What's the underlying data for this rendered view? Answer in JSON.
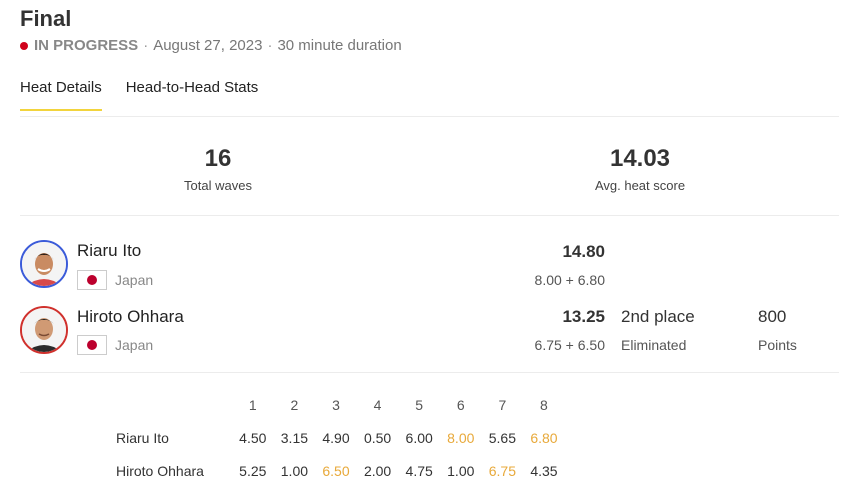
{
  "header": {
    "title": "Final",
    "status": "IN PROGRESS",
    "date": "August 27, 2023",
    "duration": "30 minute duration"
  },
  "tabs": [
    {
      "label": "Heat Details",
      "active": true
    },
    {
      "label": "Head-to-Head Stats",
      "active": false
    }
  ],
  "stats": {
    "total_waves": {
      "value": "16",
      "label": "Total waves"
    },
    "avg_score": {
      "value": "14.03",
      "label": "Avg. heat score"
    }
  },
  "riders": [
    {
      "name": "Riaru Ito",
      "country": "Japan",
      "score": "14.80",
      "breakdown": "8.00 + 6.80"
    },
    {
      "name": "Hiroto Ohhara",
      "country": "Japan",
      "score": "13.25",
      "breakdown": "6.75 + 6.50",
      "place": "2nd place",
      "place_status": "Eliminated",
      "points": "800",
      "points_label": "Points"
    }
  ],
  "wave_table": {
    "headers": [
      "1",
      "2",
      "3",
      "4",
      "5",
      "6",
      "7",
      "8"
    ],
    "rows": [
      {
        "rider": "Riaru Ito",
        "scores": [
          "4.50",
          "3.15",
          "4.90",
          "0.50",
          "6.00",
          "8.00",
          "5.65",
          "6.80"
        ],
        "best": [
          5,
          7
        ]
      },
      {
        "rider": "Hiroto Ohhara",
        "scores": [
          "5.25",
          "1.00",
          "6.50",
          "2.00",
          "4.75",
          "1.00",
          "6.75",
          "4.35"
        ],
        "best": [
          2,
          6
        ]
      }
    ]
  },
  "colors": {
    "accent_tab": "#f2d43d",
    "status_dot": "#d0021b",
    "best_wave": "#e8a93a",
    "rider1_ring": "#3b5bd9",
    "rider2_ring": "#d0312d"
  }
}
